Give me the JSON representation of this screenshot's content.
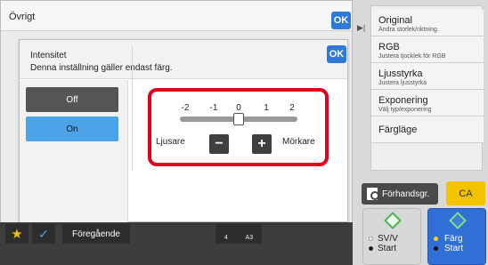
{
  "outer_dialog": {
    "title": "Övrigt",
    "ok_label": "OK"
  },
  "inner_dialog": {
    "title": "Intensitet",
    "description": "Denna inställning gäller endast färg.",
    "ok_label": "OK",
    "options": [
      {
        "label": "Off",
        "selected": false
      },
      {
        "label": "On",
        "selected": true
      }
    ],
    "slider": {
      "ticks": [
        "-2",
        "-1",
        "0",
        "1",
        "2"
      ],
      "value": 0,
      "min": -2,
      "max": 2,
      "left_label": "Ljusare",
      "right_label": "Mörkare",
      "minus_label": "−",
      "plus_label": "+"
    }
  },
  "right_panel": {
    "items": [
      {
        "title": "Original",
        "subtitle": "Ändra storlek/riktning."
      },
      {
        "title": "RGB",
        "subtitle": "Justera tjocklek för RGB"
      },
      {
        "title": "Ljusstyrka",
        "subtitle": "Justera ljusstyrka"
      },
      {
        "title": "Exponering",
        "subtitle": "Välj typ/exponering"
      },
      {
        "title": "Färgläge",
        "subtitle": ""
      }
    ]
  },
  "actions": {
    "preview_label": "Förhandsgr.",
    "ca_label": "CA",
    "start_bw": {
      "line1": "SV/V",
      "line2": "Start"
    },
    "start_color": {
      "line1": "Färg",
      "line2": "Start"
    }
  },
  "bottom_bar": {
    "previous_label": "Föregående",
    "paper_count": "4",
    "paper_size": "A3"
  },
  "colors": {
    "accent_blue": "#2f79d8",
    "highlight_red": "#e3001b",
    "ca_yellow": "#f4c300",
    "selected_option": "#4da3ea"
  }
}
